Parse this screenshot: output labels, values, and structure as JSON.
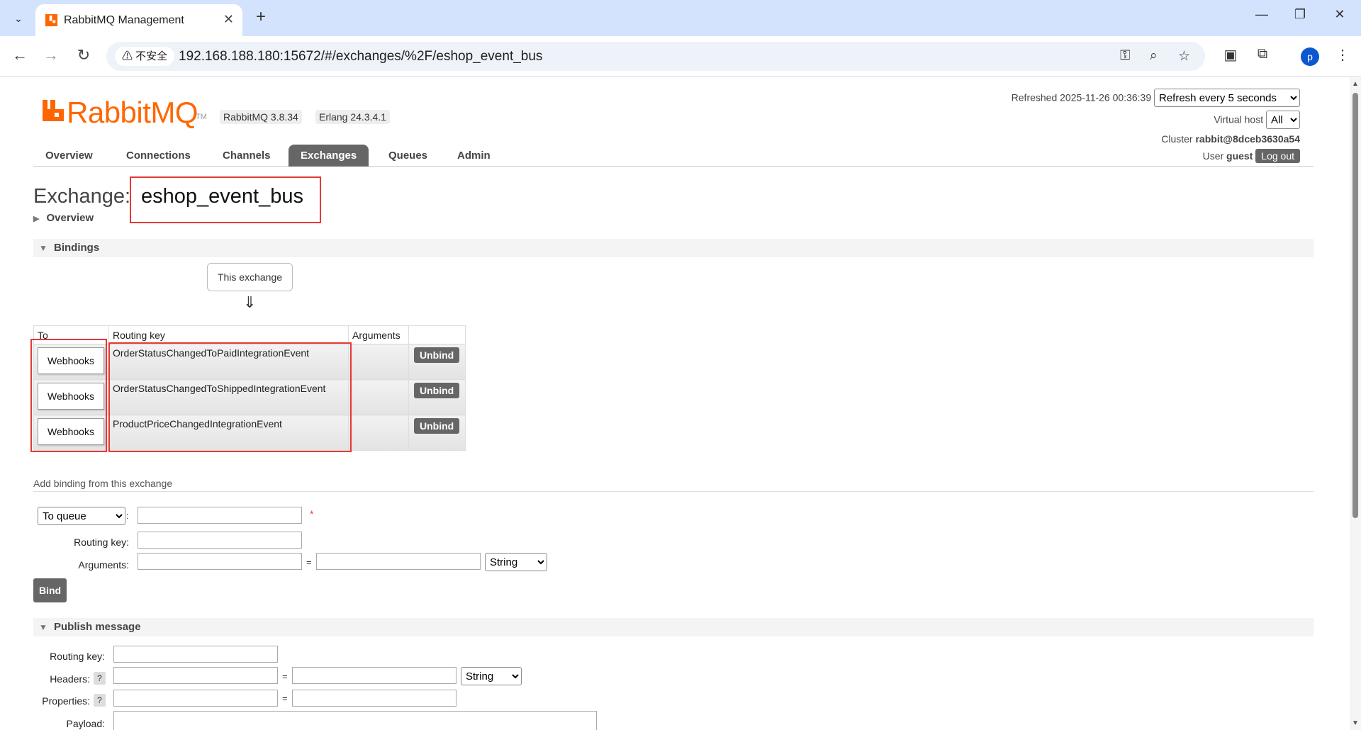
{
  "browser": {
    "tab_title": "RabbitMQ Management",
    "close_glyph": "✕",
    "new_tab_glyph": "+",
    "minimize_glyph": "—",
    "restore_glyph": "❐",
    "win_close_glyph": "✕",
    "back_glyph": "←",
    "forward_glyph": "→",
    "reload_glyph": "↻",
    "security_label": "⚠ 不安全",
    "url": "192.168.188.180:15672/#/exchanges/%2F/eshop_event_bus",
    "profile_initial": "p"
  },
  "header": {
    "logo_text": "RabbitMQ",
    "logo_tm": "TM",
    "version": "RabbitMQ 3.8.34",
    "erlang": "Erlang 24.3.4.1",
    "refreshed_text": "Refreshed 2025-11-26 00:36:39",
    "refresh_option": "Refresh every 5 seconds",
    "vhost_label": "Virtual host",
    "vhost_option": "All",
    "cluster_label": "Cluster",
    "cluster_value": "rabbit@8dceb3630a54",
    "user_label": "User",
    "user_value": "guest",
    "logout_label": "Log out"
  },
  "nav": {
    "tabs": [
      {
        "label": "Overview"
      },
      {
        "label": "Connections"
      },
      {
        "label": "Channels"
      },
      {
        "label": "Exchanges"
      },
      {
        "label": "Queues"
      },
      {
        "label": "Admin"
      }
    ],
    "active": "Exchanges"
  },
  "page": {
    "title_prefix": "Exchange:",
    "exchange_name": "eshop_event_bus",
    "overview_label": "Overview",
    "bindings_label": "Bindings",
    "this_exchange_label": "This exchange",
    "arrow_glyph": "⇓"
  },
  "bindings": {
    "headers": [
      "To",
      "Routing key",
      "Arguments",
      ""
    ],
    "rows": [
      {
        "to": "Webhooks",
        "routing_key": "OrderStatusChangedToPaidIntegrationEvent",
        "arguments": "",
        "action": "Unbind"
      },
      {
        "to": "Webhooks",
        "routing_key": "OrderStatusChangedToShippedIntegrationEvent",
        "arguments": "",
        "action": "Unbind"
      },
      {
        "to": "Webhooks",
        "routing_key": "ProductPriceChangedIntegrationEvent",
        "arguments": "",
        "action": "Unbind"
      }
    ]
  },
  "add_binding": {
    "title": "Add binding from this exchange",
    "dest_type": "To queue",
    "colon": ":",
    "required_mark": "*",
    "routing_key_label": "Routing key:",
    "arguments_label": "Arguments:",
    "eq": "=",
    "type_option": "String",
    "bind_label": "Bind"
  },
  "publish": {
    "section_label": "Publish message",
    "routing_key_label": "Routing key:",
    "headers_label": "Headers:",
    "properties_label": "Properties:",
    "payload_label": "Payload:",
    "help_glyph": "?",
    "eq": "=",
    "type_option": "String"
  }
}
